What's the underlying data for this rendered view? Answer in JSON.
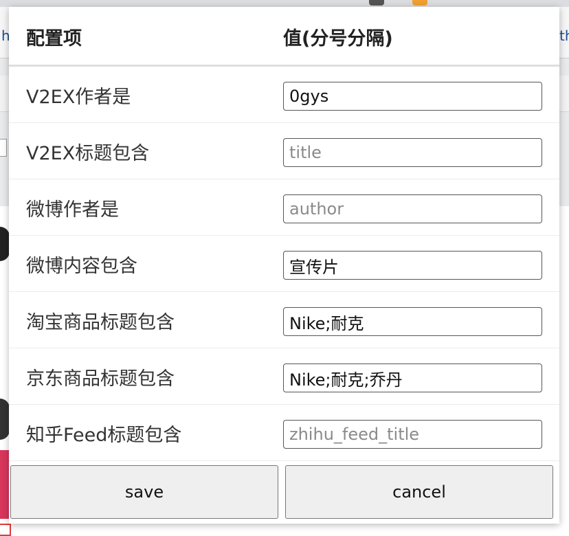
{
  "background": {
    "url_left_fragment": "h",
    "url_right_fragment": "th",
    "badge_count": "2"
  },
  "table": {
    "headers": {
      "key": "配置项",
      "value": "值(分号分隔)"
    },
    "rows": [
      {
        "label": "V2EX作者是",
        "value": "0gys",
        "placeholder": ""
      },
      {
        "label": "V2EX标题包含",
        "value": "",
        "placeholder": "title"
      },
      {
        "label": "微博作者是",
        "value": "",
        "placeholder": "author"
      },
      {
        "label": "微博内容包含",
        "value": "宣传片",
        "placeholder": ""
      },
      {
        "label": "淘宝商品标题包含",
        "value": "Nike;耐克",
        "placeholder": ""
      },
      {
        "label": "京东商品标题包含",
        "value": "Nike;耐克;乔丹",
        "placeholder": ""
      },
      {
        "label": "知乎Feed标题包含",
        "value": "",
        "placeholder": "zhihu_feed_title"
      }
    ]
  },
  "buttons": {
    "save": "save",
    "cancel": "cancel"
  },
  "colors": {
    "badge_dark": "#555555",
    "badge_orange": "#f0a030",
    "accent_red": "#e23b3b"
  }
}
